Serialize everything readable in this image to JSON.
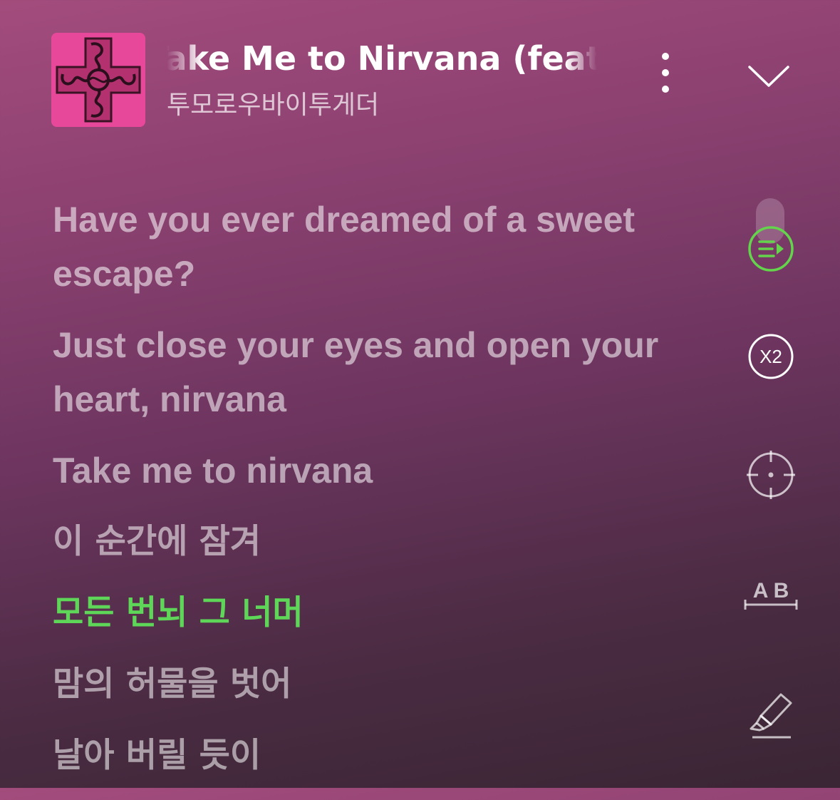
{
  "header": {
    "title": "Take Me to Nirvana (feat. 万妮达)",
    "artist": "투모로우바이투게더",
    "album_art": "cross-emblem-artwork",
    "more_icon": "more-vertical-icon",
    "collapse_icon": "chevron-down-icon"
  },
  "lyrics": [
    {
      "text": "Have you ever dreamed of a sweet escape?"
    },
    {
      "text": "Just close your eyes and open your heart, nirvana"
    },
    {
      "text": "Take me to nirvana"
    },
    {
      "text": "이 순간에 잠겨"
    },
    {
      "text": "모든 번뇌 그 너머",
      "active": true
    },
    {
      "text": "맘의 허물을 벗어"
    },
    {
      "text": "날아 버릴 듯이"
    }
  ],
  "controls": {
    "playlist_icon": "play-queue-icon",
    "speed_label": "X2",
    "focus_icon": "crosshair-icon",
    "repeat_ab_label": "A B",
    "highlight_icon": "highlighter-icon"
  },
  "colors": {
    "active_lyric": "#5ed658",
    "album_art": "#e8489a",
    "accent_green": "#63d44b"
  }
}
